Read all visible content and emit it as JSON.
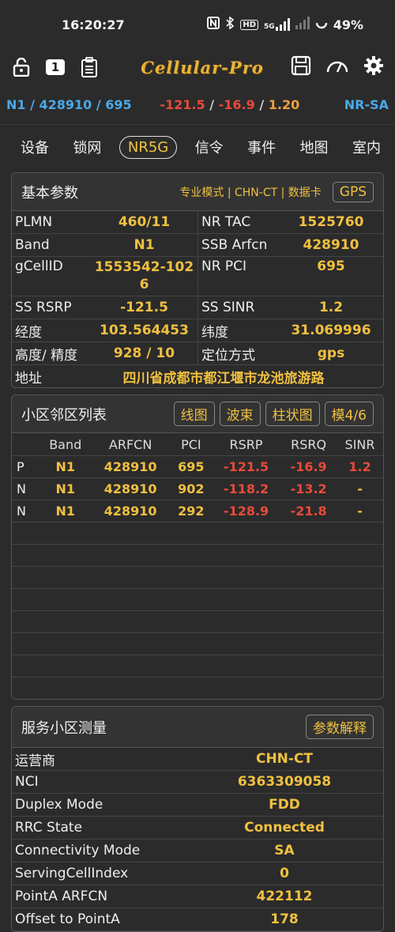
{
  "status": {
    "time": "16:20:27",
    "icons": [
      "nfc-icon",
      "bluetooth-icon",
      "hd-icon",
      "signal-5g-icon",
      "signal-icon",
      "battery-icon"
    ],
    "hd_text": "HD",
    "net_text": "5G",
    "battery": "49%"
  },
  "toolbar": {
    "brand": "Cellular-Pro",
    "badge_number": "1"
  },
  "infobar": {
    "cellinfo": "N1 / 428910 / 695",
    "rsrp": "-121.5",
    "sinr": "-16.9",
    "rsrq": "1.20",
    "sep": " / ",
    "mode": "NR-SA"
  },
  "tabs": [
    "设备",
    "锁网",
    "NR5G",
    "信令",
    "事件",
    "地图",
    "室内"
  ],
  "basic": {
    "title": "基本参数",
    "modes": "专业模式 | CHN-CT | 数据卡",
    "gps_button": "GPS",
    "rows": [
      {
        "k1": "PLMN",
        "v1": "460/11",
        "k2": "NR TAC",
        "v2": "1525760"
      },
      {
        "k1": "Band",
        "v1": "N1",
        "k2": "SSB Arfcn",
        "v2": "428910"
      },
      {
        "k1": "gCellID",
        "v1": "1553542-1026",
        "k2": "NR PCI",
        "v2": "695"
      },
      {
        "k1": "SS RSRP",
        "v1": "-121.5",
        "k2": "SS SINR",
        "v2": "1.2"
      },
      {
        "k1": "经度",
        "v1": "103.564453",
        "k2": "纬度",
        "v2": "31.069996"
      },
      {
        "k1": "高度/ 精度",
        "v1": "928 / 10",
        "k2": "定位方式",
        "v2": "gps"
      }
    ],
    "address_key": "地址",
    "address": "四川省成都市都江堰市龙池旅游路"
  },
  "neighbors": {
    "title": "小区邻区列表",
    "buttons": [
      "线图",
      "波束",
      "柱状图",
      "模4/6"
    ],
    "headers": [
      "",
      "Band",
      "ARFCN",
      "PCI",
      "RSRP",
      "RSRQ",
      "SINR"
    ],
    "rows": [
      {
        "type": "P",
        "band": "N1",
        "arfcn": "428910",
        "pci": "695",
        "rsrp": "-121.5",
        "rsrq": "-16.9",
        "sinr": "1.2"
      },
      {
        "type": "N",
        "band": "N1",
        "arfcn": "428910",
        "pci": "902",
        "rsrp": "-118.2",
        "rsrq": "-13.2",
        "sinr": "-"
      },
      {
        "type": "N",
        "band": "N1",
        "arfcn": "428910",
        "pci": "292",
        "rsrp": "-128.9",
        "rsrq": "-21.8",
        "sinr": "-"
      }
    ]
  },
  "serving": {
    "title": "服务小区测量",
    "button": "参数解释",
    "rows": [
      {
        "k": "运营商",
        "v": "CHN-CT"
      },
      {
        "k": "NCI",
        "v": "6363309058"
      },
      {
        "k": "Duplex Mode",
        "v": "FDD"
      },
      {
        "k": "RRC State",
        "v": "Connected"
      },
      {
        "k": "Connectivity Mode",
        "v": "SA"
      },
      {
        "k": "ServingCellIndex",
        "v": "0"
      },
      {
        "k": "PointA ARFCN",
        "v": "422112"
      },
      {
        "k": "Offset to PointA",
        "v": "178"
      }
    ]
  },
  "colors": {
    "accent": "#f0c040",
    "blue": "#4aa8e8",
    "red": "#e84a3a",
    "background": "#2b2b2b"
  }
}
